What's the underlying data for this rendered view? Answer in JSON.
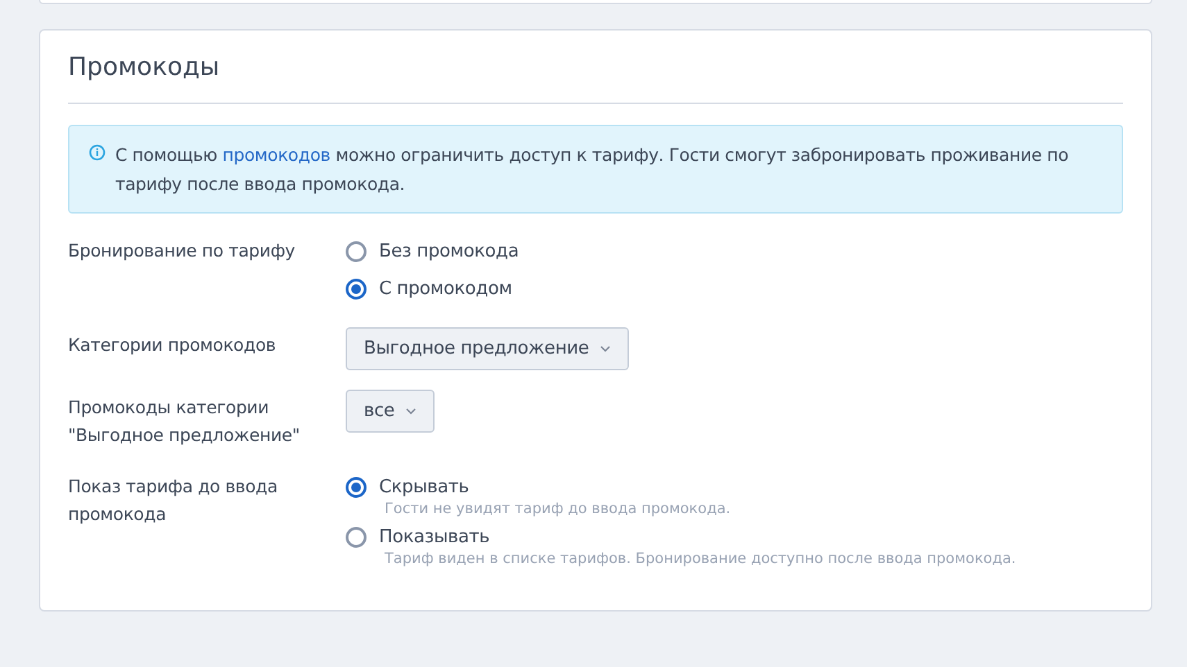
{
  "section": {
    "title": "Промокоды"
  },
  "info": {
    "before": "С помощью ",
    "link": "промокодов",
    "after": " можно ограничить доступ к тарифу. Гости смогут забронировать проживание по тарифу после ввода промокода."
  },
  "fields": [
    {
      "kind": "radio",
      "label": "Бронирование по тарифу",
      "options": [
        {
          "label": "Без промокода",
          "selected": false
        },
        {
          "label": "С промокодом",
          "selected": true
        }
      ]
    },
    {
      "kind": "select",
      "label": "Категории промокодов",
      "value": "Выгодное предложение"
    },
    {
      "kind": "select",
      "label": "Промокоды категории \"Выгодное предложение\"",
      "value": "все"
    },
    {
      "kind": "radio",
      "label": "Показ тарифа до ввода промокода",
      "options": [
        {
          "label": "Скрывать",
          "hint": "Гости не увидят тариф до ввода промокода.",
          "selected": true
        },
        {
          "label": "Показывать",
          "hint": "Тариф виден в списке тарифов. Бронирование доступно после ввода промокода.",
          "selected": false
        }
      ]
    }
  ]
}
